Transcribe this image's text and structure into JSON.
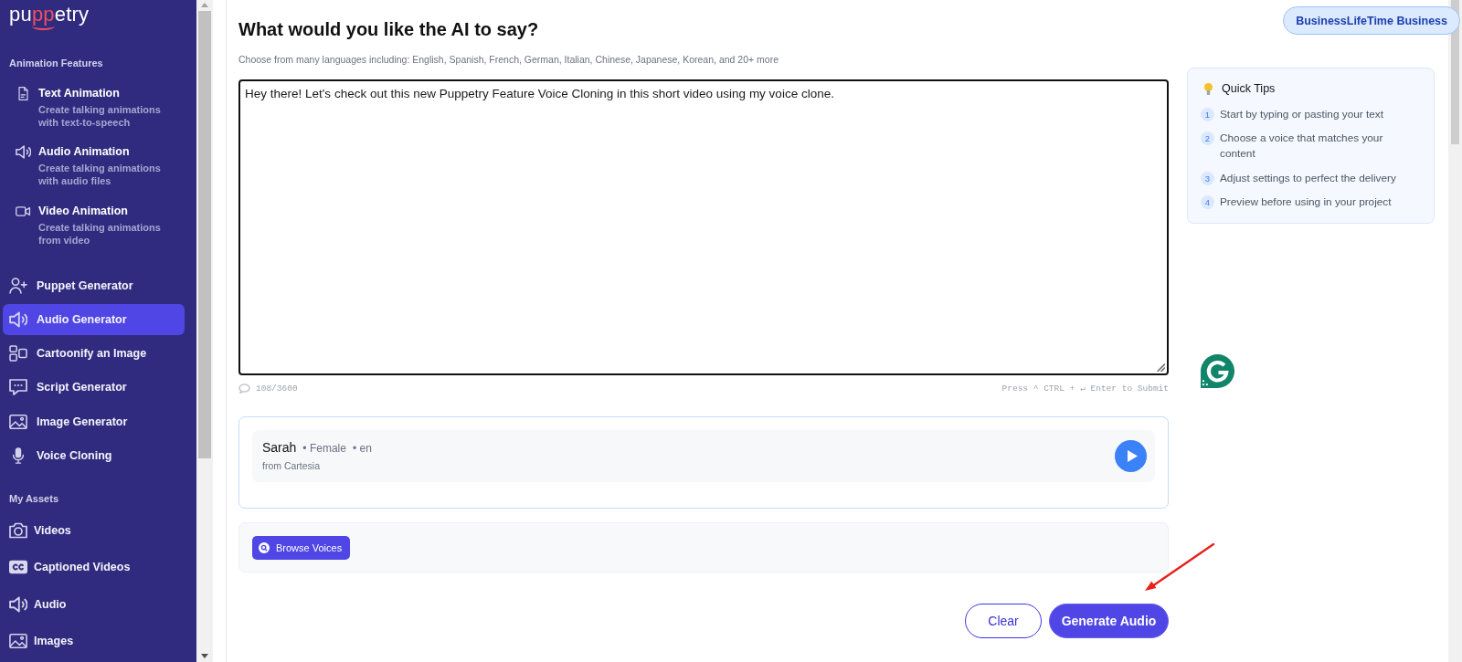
{
  "sidebar": {
    "logo": [
      {
        "text": "pu",
        "accent": false
      },
      {
        "text": "pp",
        "accent": true
      },
      {
        "text": "etry",
        "accent": false
      }
    ],
    "features_heading": "Animation Features",
    "features": [
      {
        "title": "Text Animation",
        "description": "Create talking animations\nwith text-to-speech"
      },
      {
        "title": "Audio Animation",
        "description": "Create talking animations\nwith audio files"
      },
      {
        "title": "Video Animation",
        "description": "Create talking animations\nfrom video"
      }
    ],
    "nav": [
      {
        "label": "Puppet Generator",
        "selected": false
      },
      {
        "label": "Audio Generator",
        "selected": true
      },
      {
        "label": "Cartoonify an Image",
        "selected": false
      },
      {
        "label": "Script Generator",
        "selected": false
      },
      {
        "label": "Image Generator",
        "selected": false
      },
      {
        "label": "Voice Cloning",
        "selected": false
      }
    ],
    "assets_heading": "My Assets",
    "assets": [
      {
        "label": "Videos",
        "selected": false
      },
      {
        "label": "Captioned Videos",
        "selected": false
      },
      {
        "label": "Audio",
        "selected": false
      },
      {
        "label": "Images",
        "selected": false
      }
    ]
  },
  "plan_badge": "BusinessLifeTime Business",
  "editor": {
    "title": "What would you like the AI to say?",
    "subtitle": "Choose from many languages including: English, Spanish, French, German, Italian, Chinese, Japanese, Korean, and 20+ more",
    "value": "Hey there! Let's check out this new Puppetry Feature Voice Cloning in this short video using my voice clone.",
    "counter": "108/3600",
    "shortcut_hint": "Press ^ CTRL + ↵ Enter to Submit"
  },
  "voice": {
    "name": "Sarah",
    "gender": "• Female",
    "language": "• en",
    "source": "from Cartesia"
  },
  "browse_button": "Browse Voices",
  "actions": [
    {
      "label": "Clear",
      "kind": "secondary"
    },
    {
      "label": "Generate Audio",
      "kind": "primary"
    }
  ],
  "quick_tips": {
    "title": "Quick Tips",
    "tips": [
      {
        "number": "1",
        "text": "Start by typing or pasting your text"
      },
      {
        "number": "2",
        "text": "Choose a voice that matches your content"
      },
      {
        "number": "3",
        "text": "Adjust settings to perfect the delivery"
      },
      {
        "number": "4",
        "text": "Preview before using in your project"
      }
    ]
  }
}
